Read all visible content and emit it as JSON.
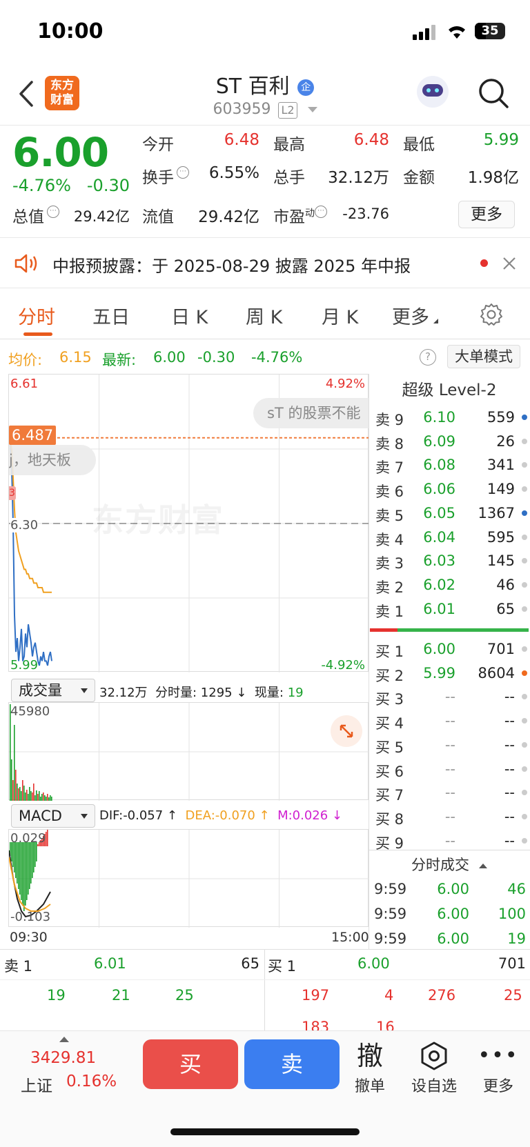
{
  "status": {
    "time": "10:00",
    "battery": "35"
  },
  "header": {
    "logo_line1": "东方",
    "logo_line2": "财富",
    "name": "ST 百利",
    "badge": "企",
    "code": "603959",
    "level": "L2"
  },
  "quote": {
    "price": "6.00",
    "change_pct": "-4.76%",
    "change": "-0.30",
    "open_label": "今开",
    "open": "6.48",
    "high_label": "最高",
    "high": "6.48",
    "low_label": "最低",
    "low": "5.99",
    "turnover_label": "换手",
    "turnover": "6.55%",
    "volume_label": "总手",
    "volume": "32.12万",
    "amount_label": "金额",
    "amount": "1.98亿",
    "mktcap_label": "总值",
    "mktcap": "29.42亿",
    "float_label": "流值",
    "float": "29.42亿",
    "pe_label": "市盈",
    "pe_sup": "动",
    "pe": "-23.76",
    "more": "更多"
  },
  "notice": {
    "text": "中报预披露：于 2025-08-29 披露 2025 年中报"
  },
  "tabs": [
    "分时",
    "五日",
    "日 K",
    "周 K",
    "月 K",
    "更多"
  ],
  "infoline": {
    "avg_label": "均价:",
    "avg": "6.15",
    "last_label": "最新:",
    "last": "6.00",
    "chg": "-0.30",
    "pct": "-4.76%",
    "mode": "大单模式"
  },
  "chart": {
    "top_price": "6.61",
    "top_pct": "4.92%",
    "bottom_price": "5.99",
    "bottom_pct": "-4.92%",
    "mid_price": "6.30",
    "marker": "6.487",
    "bubble1": "sT 的股票不能",
    "bubble2": "j，地天板",
    "small_tag": "3",
    "watermark": "东方财富",
    "time_start": "09:30",
    "time_end": "15:00",
    "chart_data": {
      "type": "line",
      "ylim": [
        5.99,
        6.61
      ],
      "series": [
        {
          "name": "最新",
          "color": "#2f6fc4",
          "values": [
            6.48,
            6.42,
            6.3,
            6.1,
            6.02,
            6.05,
            6.0,
            6.03,
            6.07,
            6.0,
            6.01,
            6.06,
            6.03,
            6.08,
            6.06,
            6.04,
            6.01,
            6.03,
            6.04,
            6.02,
            6.0,
            5.99,
            6.01,
            6.0,
            6.02,
            6.0,
            6.0,
            5.99,
            6.01,
            6.02,
            6.0
          ]
        },
        {
          "name": "均价",
          "color": "#f0a020",
          "values": [
            6.48,
            6.46,
            6.4,
            6.33,
            6.28,
            6.26,
            6.24,
            6.23,
            6.22,
            6.21,
            6.2,
            6.2,
            6.19,
            6.19,
            6.18,
            6.18,
            6.18,
            6.17,
            6.17,
            6.17,
            6.16,
            6.16,
            6.16,
            6.16,
            6.15,
            6.15,
            6.15,
            6.15,
            6.15,
            6.15,
            6.15
          ]
        }
      ]
    }
  },
  "volume": {
    "selector": "成交量",
    "info_total": "32.12万",
    "info_label": "分时量:",
    "info_value": "1295 ↓",
    "now_label": "现量:",
    "now_value": "19",
    "max": "45980"
  },
  "macd": {
    "selector": "MACD",
    "dif": "DIF:-0.057 ↑",
    "dea": "DEA:-0.070 ↑",
    "m": "M:0.026 ↓",
    "top": "0.029",
    "bottom": "-0.103"
  },
  "book": {
    "title": "超级 Level-2",
    "asks": [
      {
        "label": "卖 9",
        "price": "6.10",
        "vol": "559",
        "dot": "#2f6fc4"
      },
      {
        "label": "卖 8",
        "price": "6.09",
        "vol": "26",
        "dot": "#ccc"
      },
      {
        "label": "卖 7",
        "price": "6.08",
        "vol": "341",
        "dot": "#ccc"
      },
      {
        "label": "卖 6",
        "price": "6.06",
        "vol": "149",
        "dot": "#ccc"
      },
      {
        "label": "卖 5",
        "price": "6.05",
        "vol": "1367",
        "dot": "#2f6fc4"
      },
      {
        "label": "卖 4",
        "price": "6.04",
        "vol": "595",
        "dot": "#ccc"
      },
      {
        "label": "卖 3",
        "price": "6.03",
        "vol": "145",
        "dot": "#ccc"
      },
      {
        "label": "卖 2",
        "price": "6.02",
        "vol": "46",
        "dot": "#ccc"
      },
      {
        "label": "卖 1",
        "price": "6.01",
        "vol": "65",
        "dot": "#ccc"
      }
    ],
    "bids": [
      {
        "label": "买 1",
        "price": "6.00",
        "vol": "701",
        "dot": "#ccc"
      },
      {
        "label": "买 2",
        "price": "5.99",
        "vol": "8604",
        "dot": "#f06a1e"
      },
      {
        "label": "买 3",
        "price": "--",
        "vol": "--",
        "dot": "#ccc"
      },
      {
        "label": "买 4",
        "price": "--",
        "vol": "--",
        "dot": "#ccc"
      },
      {
        "label": "买 5",
        "price": "--",
        "vol": "--",
        "dot": "#ccc"
      },
      {
        "label": "买 6",
        "price": "--",
        "vol": "--",
        "dot": "#ccc"
      },
      {
        "label": "买 7",
        "price": "--",
        "vol": "--",
        "dot": "#ccc"
      },
      {
        "label": "买 8",
        "price": "--",
        "vol": "--",
        "dot": "#ccc"
      },
      {
        "label": "买 9",
        "price": "--",
        "vol": "--",
        "dot": "#ccc"
      }
    ],
    "trades_title": "分时成交",
    "trades": [
      {
        "time": "9:59",
        "price": "6.00",
        "vol": "46"
      },
      {
        "time": "9:59",
        "price": "6.00",
        "vol": "100"
      },
      {
        "time": "9:59",
        "price": "6.00",
        "vol": "19"
      }
    ]
  },
  "bottom_quote": {
    "sell_label": "卖 1",
    "sell_price": "6.01",
    "sell_vol": "65",
    "buy_label": "买 1",
    "buy_price": "6.00",
    "buy_vol": "701",
    "sell_queue": [
      "19",
      "21",
      "25"
    ],
    "buy_queue": [
      "197",
      "4",
      "276",
      "25"
    ],
    "buy_queue2": [
      "183",
      "16"
    ]
  },
  "bottombar": {
    "index_value": "3429.81",
    "index_name": "上证",
    "index_pct": "0.16%",
    "buy": "买",
    "sell": "卖",
    "cancel_icon": "撤",
    "cancel": "撤单",
    "watch": "设自选",
    "more": "更多"
  }
}
